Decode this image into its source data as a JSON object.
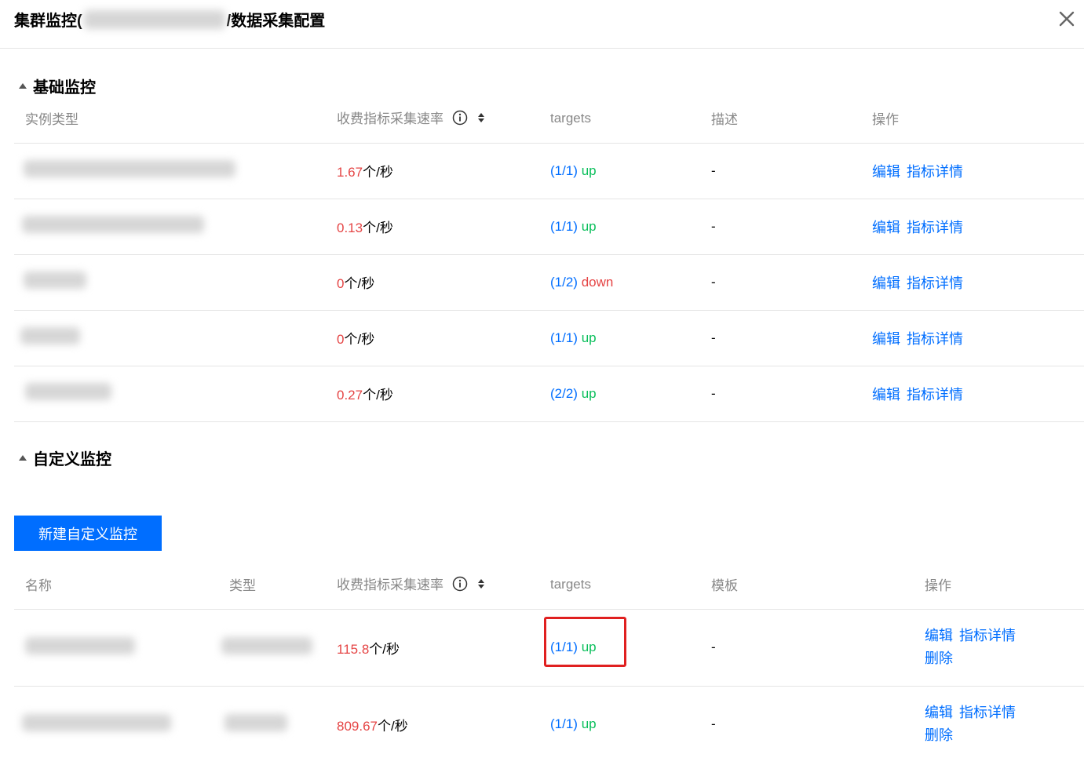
{
  "header": {
    "title_prefix": "集群监控(",
    "title_suffix": "/数据采集配置"
  },
  "basic": {
    "title": "基础监控",
    "columns": [
      "实例类型",
      "收费指标采集速率",
      "targets",
      "描述",
      "操作"
    ],
    "rows": [
      {
        "rate_value": "1.67",
        "rate_unit": "个/秒",
        "targets_count": "(1/1)",
        "targets_status": "up",
        "desc": "-"
      },
      {
        "rate_value": "0.13",
        "rate_unit": "个/秒",
        "targets_count": "(1/1)",
        "targets_status": "up",
        "desc": "-"
      },
      {
        "rate_value": "0",
        "rate_unit": "个/秒",
        "targets_count": "(1/2)",
        "targets_status": "down",
        "desc": "-"
      },
      {
        "rate_value": "0",
        "rate_unit": "个/秒",
        "targets_count": "(1/1)",
        "targets_status": "up",
        "desc": "-"
      },
      {
        "rate_value": "0.27",
        "rate_unit": "个/秒",
        "targets_count": "(2/2)",
        "targets_status": "up",
        "desc": "-"
      }
    ],
    "actions": {
      "edit": "编辑",
      "detail": "指标详情"
    }
  },
  "custom": {
    "title": "自定义监控",
    "new_button": "新建自定义监控",
    "columns": [
      "名称",
      "类型",
      "收费指标采集速率",
      "targets",
      "模板",
      "操作"
    ],
    "rows": [
      {
        "rate_value": "115.8",
        "rate_unit": "个/秒",
        "targets_count": "(1/1)",
        "targets_status": "up",
        "template": "-"
      },
      {
        "rate_value": "809.67",
        "rate_unit": "个/秒",
        "targets_count": "(1/1)",
        "targets_status": "up",
        "template": "-"
      }
    ],
    "actions": {
      "edit": "编辑",
      "detail": "指标详情",
      "delete": "删除"
    }
  },
  "colors": {
    "accent": "#006eff",
    "up": "#0abf5b",
    "down": "#e54545",
    "highlight": "#e02020"
  }
}
